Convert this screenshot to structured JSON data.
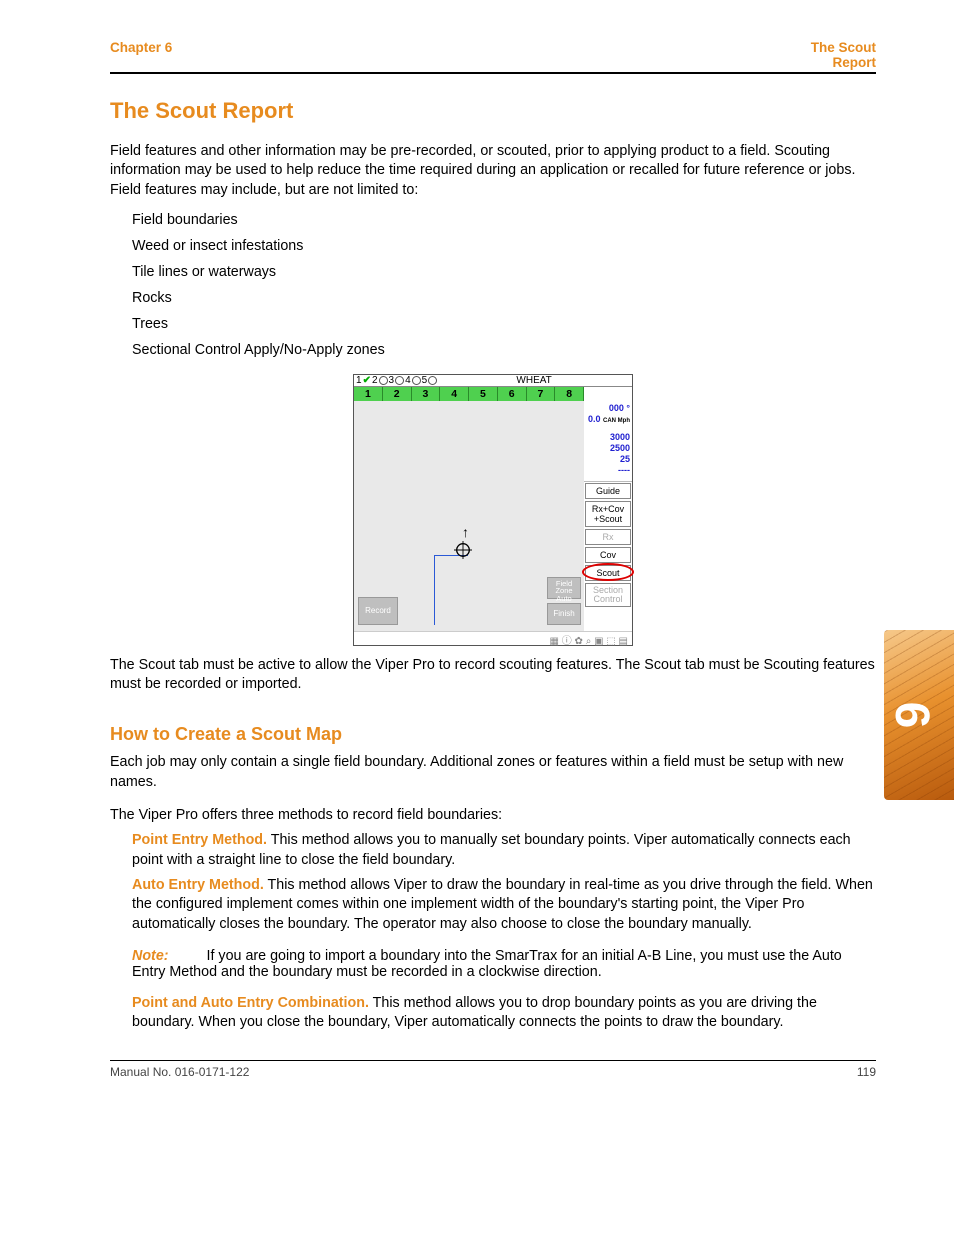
{
  "header": {
    "chapter": "Chapter 6",
    "right_text": "The Scout\nReport"
  },
  "section_title": "The Scout Report",
  "intro": "Field features and other information may be pre-recorded, or scouted, prior to applying product to a field. Scouting information may be used to help reduce the time required during an application or recalled for future reference or jobs. Field features may include, but are not limited to:",
  "features": [
    "Field boundaries",
    "Weed or insect infestations",
    "Tile lines or waterways",
    "Rocks",
    "Trees",
    "Sectional Control Apply/No-Apply zones"
  ],
  "screenshot": {
    "radios": [
      "1",
      "2",
      "3",
      "4",
      "5"
    ],
    "crop": "WHEAT",
    "sections": [
      "1",
      "2",
      "3",
      "4",
      "5",
      "6",
      "7",
      "8"
    ],
    "status": {
      "heading": "000 °",
      "speed": "0.0",
      "speed_unit": "CAN Mph",
      "r1": "3000",
      "r2": "2500",
      "r3": "25",
      "r4": "----"
    },
    "buttons": {
      "guide": "Guide",
      "rxcov": "Rx+Cov +Scout",
      "rx": "Rx",
      "cov": "Cov",
      "scout": "Scout",
      "section": "Section Control",
      "record": "Record",
      "fieldzone": "Field Zone Auto",
      "finish": "Finish"
    }
  },
  "after_ss": "The Scout tab must be active to allow the Viper Pro to record scouting features. The Scout tab must be Scouting features must be recorded or imported.",
  "sub_heading": "How to Create a Scout Map",
  "sub_intro1": "Each job may only contain a single field boundary. Additional zones or features within a field must be setup with new names.",
  "sub_intro2": "The Viper Pro offers three methods to record field boundaries:",
  "methods": {
    "m1_label": "Point Entry Method.",
    "m1_text": " This method allows you to manually set boundary points. Viper automatically connects each point with a straight line to close the field boundary.",
    "m2_label": "Auto Entry Method.",
    "m2_text": " This method allows Viper to draw the boundary in real-time as you drive through the field. When the configured implement comes within one implement width of the boundary's starting point, the Viper Pro automatically closes the boundary. The operator may also choose to close the boundary manually.",
    "note_label": "Note:",
    "note_text": "If you are going to import a boundary into the SmarTrax for an initial A-B Line, you must use the Auto Entry Method and the boundary must be recorded in a clockwise direction.",
    "m3_label": "Point and Auto Entry Combination.",
    "m3_text": " This method allows you to drop boundary points as you are driving the boundary. When you close the boundary, Viper automatically connects the points to draw the boundary."
  },
  "footer": {
    "left": "Manual No. 016-0171-122",
    "right": "119"
  },
  "tab_number": "6"
}
